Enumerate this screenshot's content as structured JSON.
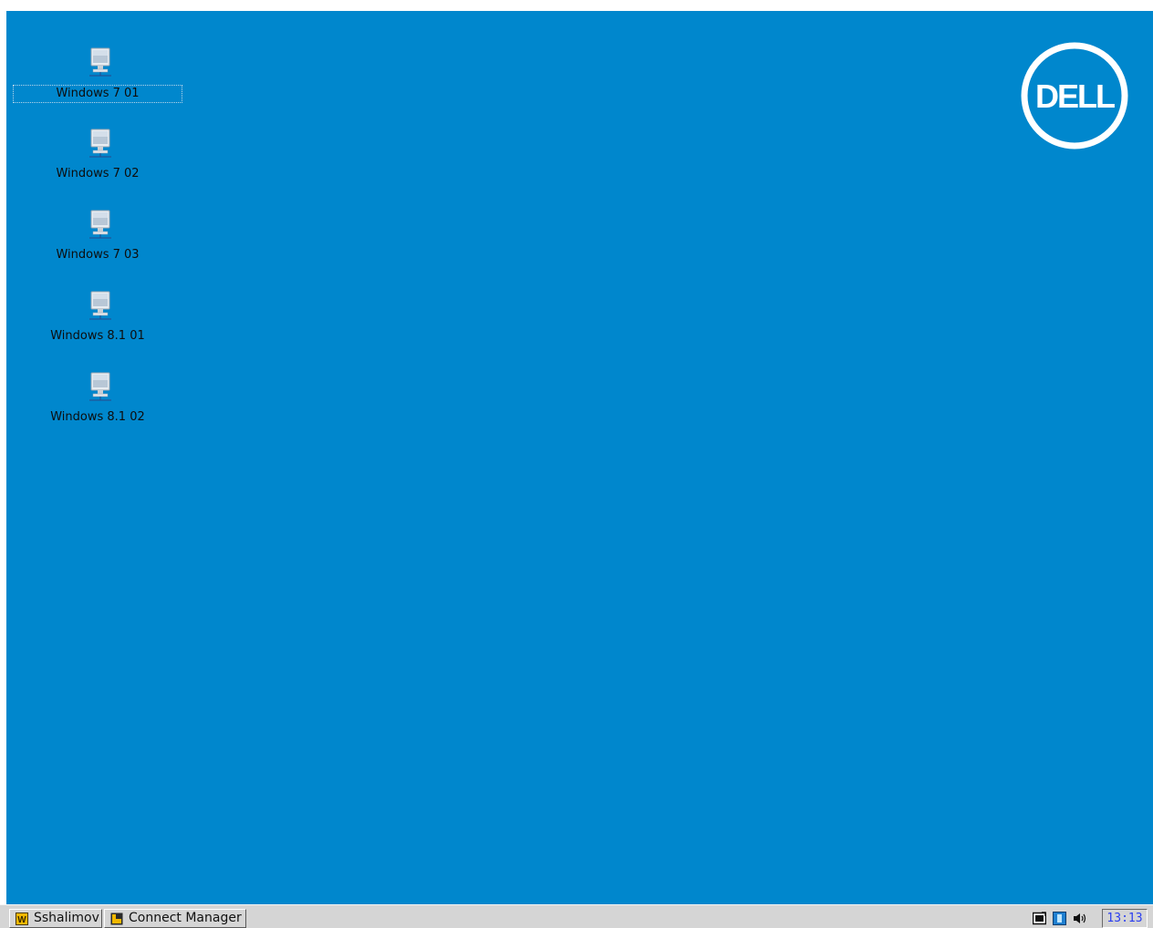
{
  "desktop": {
    "background_color": "#0087cd",
    "icons": [
      {
        "label": "Windows 7 01",
        "icon": "computer-icon",
        "selected": true
      },
      {
        "label": "Windows 7 02",
        "icon": "computer-icon",
        "selected": false
      },
      {
        "label": "Windows 7 03",
        "icon": "computer-icon",
        "selected": false
      },
      {
        "label": "Windows 8.1 01",
        "icon": "computer-icon",
        "selected": false
      },
      {
        "label": "Windows 8.1 02",
        "icon": "computer-icon",
        "selected": false
      }
    ],
    "logo": {
      "text": "DELL",
      "color": "#ffffff"
    }
  },
  "taskbar": {
    "buttons": [
      {
        "label": "Sshalimov",
        "icon": "user-icon"
      },
      {
        "label": "Connect Manager",
        "icon": "connect-manager-icon"
      }
    ],
    "tray": {
      "icons": [
        "display-icon",
        "network-icon",
        "volume-icon"
      ],
      "clock": "13:13"
    }
  }
}
